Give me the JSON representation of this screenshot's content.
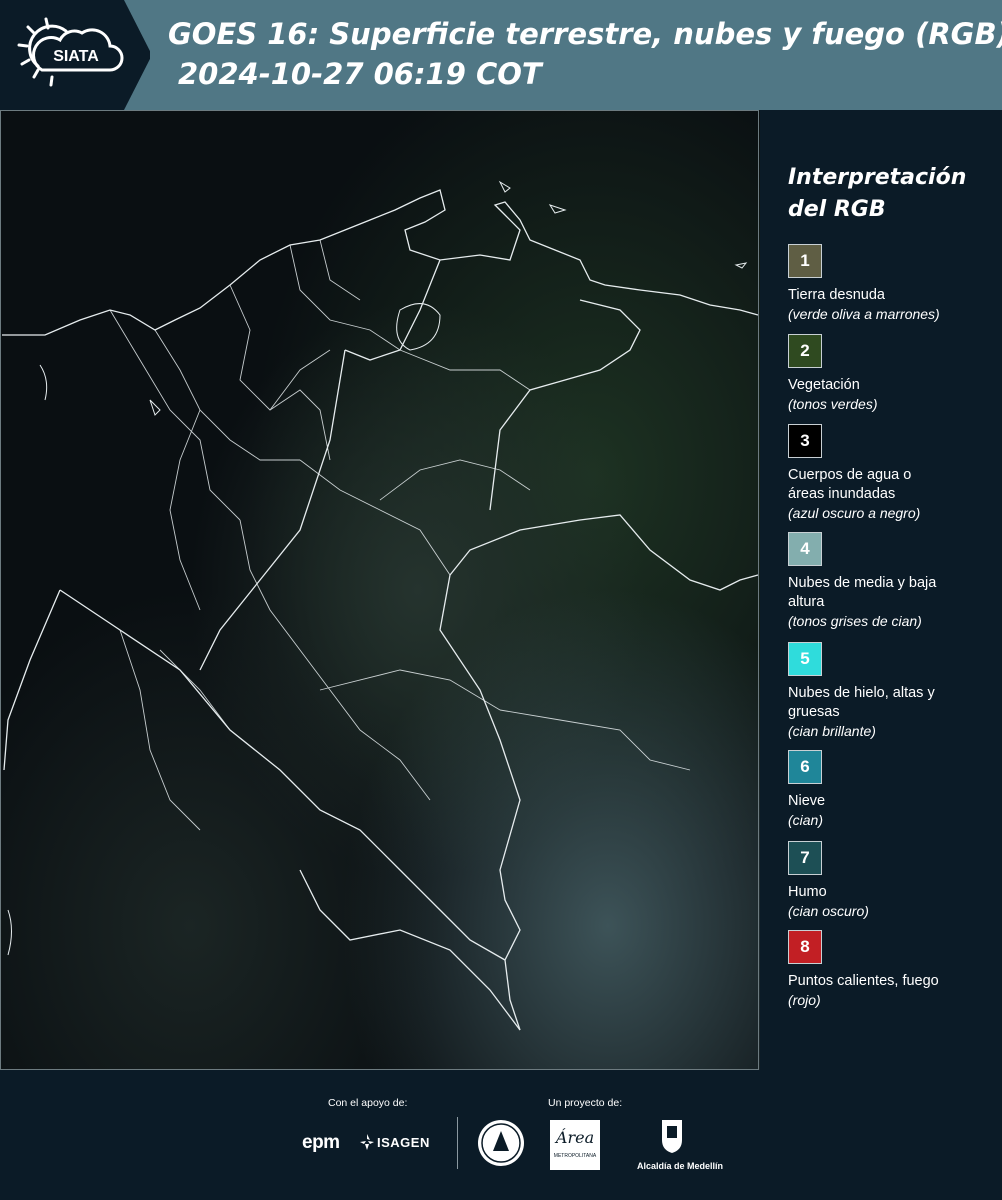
{
  "header": {
    "logo_text": "SIATA",
    "title_line1": "GOES 16: Superficie terrestre, nubes y fuego (RGB)",
    "title_line2": "2024-10-27 06:19 COT"
  },
  "legend": {
    "title_line1": "Interpretación",
    "title_line2": "del RGB",
    "items": [
      {
        "num": "1",
        "label": "Tierra desnuda",
        "sub": "(verde oliva a marrones)",
        "color": "#5f5e44"
      },
      {
        "num": "2",
        "label": "Vegetación",
        "sub": "(tonos verdes)",
        "color": "#2f4a20"
      },
      {
        "num": "3",
        "label": "Cuerpos de agua o áreas inundadas",
        "sub": "(azul oscuro a negro)",
        "color": "#000000"
      },
      {
        "num": "4",
        "label": "Nubes de media y baja altura",
        "sub": "(tonos grises de cian)",
        "color": "#83aeae"
      },
      {
        "num": "5",
        "label": "Nubes de hielo, altas y gruesas",
        "sub": "(cian brillante)",
        "color": "#2fdcdc"
      },
      {
        "num": "6",
        "label": "Nieve",
        "sub": "(cian)",
        "color": "#1f8699"
      },
      {
        "num": "7",
        "label": "Humo",
        "sub": "(cian oscuro)",
        "color": "#1d4f55"
      },
      {
        "num": "8",
        "label": "Puntos calientes, fuego",
        "sub": "(rojo)",
        "color": "#c21f24"
      }
    ]
  },
  "footer": {
    "support_label": "Con el apoyo de:",
    "project_label": "Un proyecto de:",
    "logos": {
      "epm": "epm",
      "isagen": "ISAGEN",
      "area_metro": "Área",
      "area_metro_sub": "METROPOLITANA",
      "alcaldia": "Alcaldía de Medellín"
    }
  },
  "colors": {
    "header_bg": "#507785",
    "logo_bg": "#0b1b27",
    "page_bg": "#0b1b27",
    "map_bg": "#0a0f12"
  }
}
